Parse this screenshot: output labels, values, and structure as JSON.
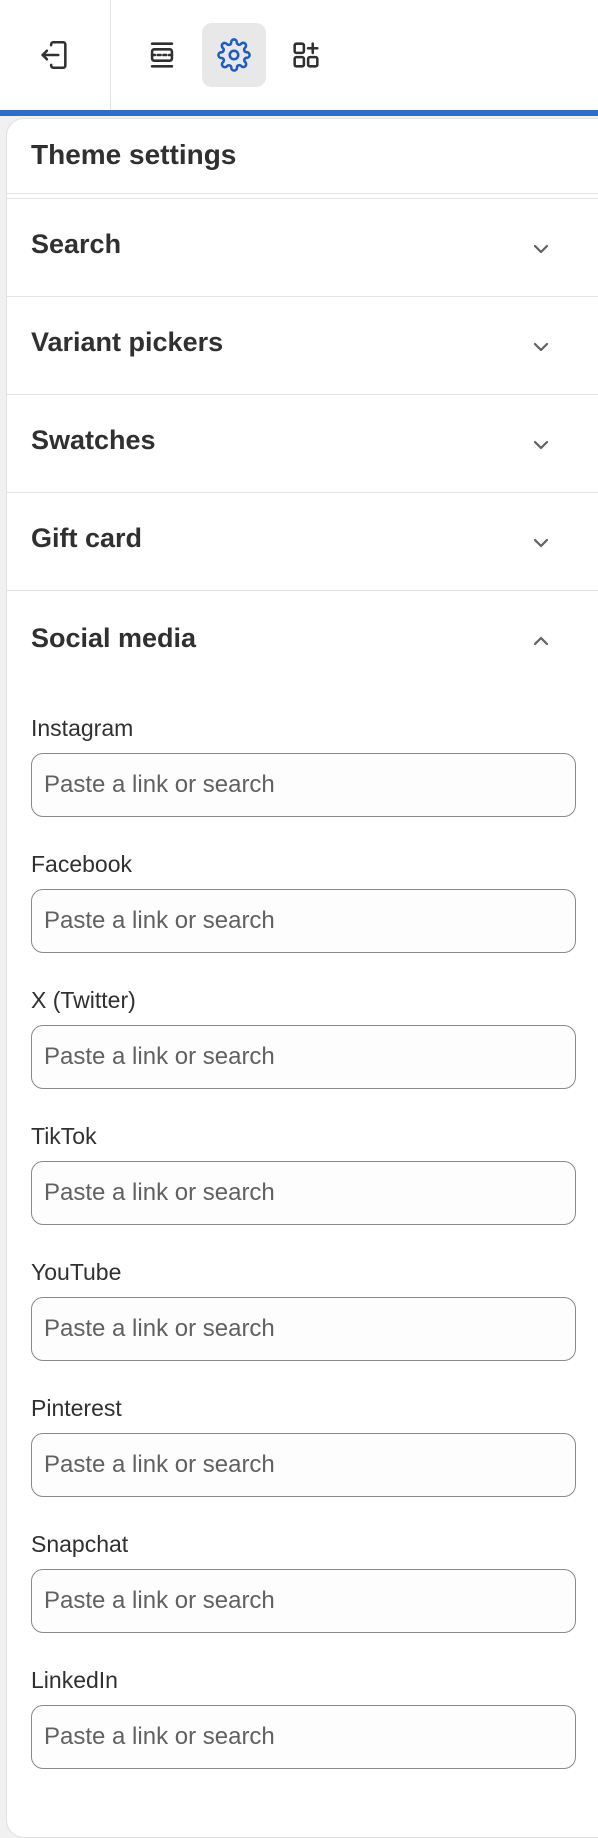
{
  "toolbar": {
    "buttons": [
      {
        "icon": "exit-icon"
      },
      {
        "icon": "sections-icon"
      },
      {
        "icon": "gear-icon",
        "active": true
      },
      {
        "icon": "app-blocks-icon"
      }
    ],
    "accent_color": "#2c6ecb",
    "active_icon_color": "#1f5bc4"
  },
  "panel": {
    "title": "Theme settings",
    "accordions": [
      {
        "label": "Search",
        "expanded": false
      },
      {
        "label": "Variant pickers",
        "expanded": false
      },
      {
        "label": "Swatches",
        "expanded": false
      },
      {
        "label": "Gift card",
        "expanded": false
      }
    ],
    "social": {
      "label": "Social media",
      "expanded": true,
      "fields": [
        {
          "label": "Instagram",
          "placeholder": "Paste a link or search",
          "value": ""
        },
        {
          "label": "Facebook",
          "placeholder": "Paste a link or search",
          "value": ""
        },
        {
          "label": "X (Twitter)",
          "placeholder": "Paste a link or search",
          "value": ""
        },
        {
          "label": "TikTok",
          "placeholder": "Paste a link or search",
          "value": ""
        },
        {
          "label": "YouTube",
          "placeholder": "Paste a link or search",
          "value": ""
        },
        {
          "label": "Pinterest",
          "placeholder": "Paste a link or search",
          "value": ""
        },
        {
          "label": "Snapchat",
          "placeholder": "Paste a link or search",
          "value": ""
        },
        {
          "label": "LinkedIn",
          "placeholder": "Paste a link or search",
          "value": ""
        }
      ]
    }
  }
}
